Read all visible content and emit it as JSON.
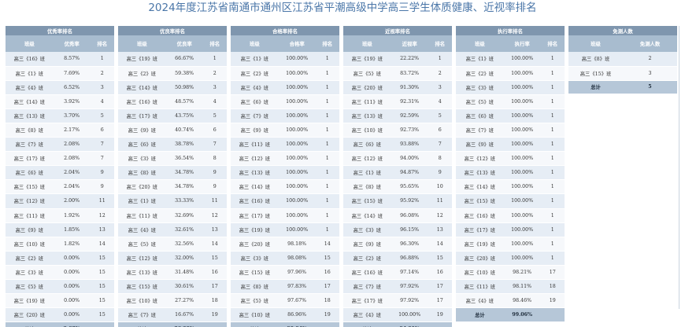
{
  "page_title": "2024年度江苏省南通市通州区江苏省平潮高级中学高三学生体质健康、近视率排名",
  "panels": [
    {
      "caption": "优秀率排名",
      "headers": [
        "班级",
        "优秀率",
        "排名"
      ],
      "rows": [
        [
          "高三《16》班",
          "8.57%",
          "1"
        ],
        [
          "高三《1》班",
          "7.69%",
          "2"
        ],
        [
          "高三《4》班",
          "6.52%",
          "3"
        ],
        [
          "高三《14》班",
          "3.92%",
          "4"
        ],
        [
          "高三《13》班",
          "3.70%",
          "5"
        ],
        [
          "高三《8》班",
          "2.17%",
          "6"
        ],
        [
          "高三《7》班",
          "2.08%",
          "7"
        ],
        [
          "高三《17》班",
          "2.08%",
          "7"
        ],
        [
          "高三《6》班",
          "2.04%",
          "9"
        ],
        [
          "高三《15》班",
          "2.04%",
          "9"
        ],
        [
          "高三《12》班",
          "2.00%",
          "11"
        ],
        [
          "高三《11》班",
          "1.92%",
          "12"
        ],
        [
          "高三《9》班",
          "1.85%",
          "13"
        ],
        [
          "高三《10》班",
          "1.82%",
          "14"
        ],
        [
          "高三《2》班",
          "0.00%",
          "15"
        ],
        [
          "高三《3》班",
          "0.00%",
          "15"
        ],
        [
          "高三《5》班",
          "0.00%",
          "15"
        ],
        [
          "高三《19》班",
          "0.00%",
          "15"
        ],
        [
          "高三《20》班",
          "0.00%",
          "15"
        ]
      ],
      "total": [
        "总计",
        "2.63%",
        ""
      ]
    },
    {
      "caption": "优良率排名",
      "headers": [
        "班级",
        "优良率",
        "排名"
      ],
      "rows": [
        [
          "高三《19》班",
          "66.67%",
          "1"
        ],
        [
          "高三《2》班",
          "59.38%",
          "2"
        ],
        [
          "高三《14》班",
          "50.98%",
          "3"
        ],
        [
          "高三《16》班",
          "48.57%",
          "4"
        ],
        [
          "高三《17》班",
          "43.75%",
          "5"
        ],
        [
          "高三《9》班",
          "40.74%",
          "6"
        ],
        [
          "高三《6》班",
          "38.78%",
          "7"
        ],
        [
          "高三《3》班",
          "36.54%",
          "8"
        ],
        [
          "高三《8》班",
          "34.78%",
          "9"
        ],
        [
          "高三《20》班",
          "34.78%",
          "9"
        ],
        [
          "高三《1》班",
          "33.33%",
          "11"
        ],
        [
          "高三《11》班",
          "32.69%",
          "12"
        ],
        [
          "高三《4》班",
          "32.61%",
          "13"
        ],
        [
          "高三《5》班",
          "32.56%",
          "14"
        ],
        [
          "高三《12》班",
          "32.00%",
          "15"
        ],
        [
          "高三《13》班",
          "31.48%",
          "16"
        ],
        [
          "高三《15》班",
          "30.61%",
          "17"
        ],
        [
          "高三《10》班",
          "27.27%",
          "18"
        ],
        [
          "高三《7》班",
          "16.67%",
          "19"
        ]
      ],
      "total": [
        "总计",
        "36.29%",
        ""
      ]
    },
    {
      "caption": "合格率排名",
      "headers": [
        "班级",
        "合格率",
        "排名"
      ],
      "rows": [
        [
          "高三《1》班",
          "100.00%",
          "1"
        ],
        [
          "高三《2》班",
          "100.00%",
          "1"
        ],
        [
          "高三《4》班",
          "100.00%",
          "1"
        ],
        [
          "高三《6》班",
          "100.00%",
          "1"
        ],
        [
          "高三《7》班",
          "100.00%",
          "1"
        ],
        [
          "高三《9》班",
          "100.00%",
          "1"
        ],
        [
          "高三《11》班",
          "100.00%",
          "1"
        ],
        [
          "高三《12》班",
          "100.00%",
          "1"
        ],
        [
          "高三《13》班",
          "100.00%",
          "1"
        ],
        [
          "高三《14》班",
          "100.00%",
          "1"
        ],
        [
          "高三《16》班",
          "100.00%",
          "1"
        ],
        [
          "高三《17》班",
          "100.00%",
          "1"
        ],
        [
          "高三《19》班",
          "100.00%",
          "1"
        ],
        [
          "高三《20》班",
          "98.18%",
          "14"
        ],
        [
          "高三《3》班",
          "98.08%",
          "15"
        ],
        [
          "高三《15》班",
          "97.96%",
          "16"
        ],
        [
          "高三《8》班",
          "97.83%",
          "17"
        ],
        [
          "高三《5》班",
          "97.67%",
          "18"
        ],
        [
          "高三《10》班",
          "86.96%",
          "19"
        ]
      ],
      "total": [
        "总计",
        "99.04%",
        ""
      ]
    },
    {
      "caption": "近视率排名",
      "headers": [
        "班级",
        "近视率",
        "排名"
      ],
      "rows": [
        [
          "高三《19》班",
          "22.22%",
          "1"
        ],
        [
          "高三《5》班",
          "83.72%",
          "2"
        ],
        [
          "高三《20》班",
          "91.30%",
          "3"
        ],
        [
          "高三《11》班",
          "92.31%",
          "4"
        ],
        [
          "高三《13》班",
          "92.59%",
          "5"
        ],
        [
          "高三《10》班",
          "92.73%",
          "6"
        ],
        [
          "高三《6》班",
          "93.88%",
          "7"
        ],
        [
          "高三《12》班",
          "94.00%",
          "8"
        ],
        [
          "高三《1》班",
          "94.87%",
          "9"
        ],
        [
          "高三《8》班",
          "95.65%",
          "10"
        ],
        [
          "高三《15》班",
          "95.92%",
          "11"
        ],
        [
          "高三《14》班",
          "96.08%",
          "12"
        ],
        [
          "高三《3》班",
          "96.15%",
          "13"
        ],
        [
          "高三《9》班",
          "96.30%",
          "14"
        ],
        [
          "高三《2》班",
          "96.88%",
          "15"
        ],
        [
          "高三《16》班",
          "97.14%",
          "16"
        ],
        [
          "高三《7》班",
          "97.92%",
          "17"
        ],
        [
          "高三《17》班",
          "97.92%",
          "17"
        ],
        [
          "高三《4》班",
          "100.00%",
          "19"
        ]
      ],
      "total": [
        "总计",
        "94.01%",
        ""
      ]
    },
    {
      "caption": "执行率排名",
      "headers": [
        "班级",
        "执行率",
        "排名"
      ],
      "rows": [
        [
          "高三《1》班",
          "100.00%",
          "1"
        ],
        [
          "高三《2》班",
          "100.00%",
          "1"
        ],
        [
          "高三《3》班",
          "100.00%",
          "1"
        ],
        [
          "高三《5》班",
          "100.00%",
          "1"
        ],
        [
          "高三《6》班",
          "100.00%",
          "1"
        ],
        [
          "高三《7》班",
          "100.00%",
          "1"
        ],
        [
          "高三《9》班",
          "100.00%",
          "1"
        ],
        [
          "高三《12》班",
          "100.00%",
          "1"
        ],
        [
          "高三《13》班",
          "100.00%",
          "1"
        ],
        [
          "高三《14》班",
          "100.00%",
          "1"
        ],
        [
          "高三《15》班",
          "100.00%",
          "1"
        ],
        [
          "高三《16》班",
          "100.00%",
          "1"
        ],
        [
          "高三《17》班",
          "100.00%",
          "1"
        ],
        [
          "高三《19》班",
          "100.00%",
          "1"
        ],
        [
          "高三《20》班",
          "100.00%",
          "1"
        ],
        [
          "高三《10》班",
          "98.21%",
          "17"
        ],
        [
          "高三《11》班",
          "98.11%",
          "18"
        ],
        [
          "高三《4》班",
          "98.46%",
          "19"
        ]
      ],
      "total": [
        "总计",
        "99.06%",
        ""
      ]
    },
    {
      "caption": "免测人数",
      "headers": [
        "班级",
        "免测人数"
      ],
      "rows": [
        [
          "高三《8》班",
          "2"
        ],
        [
          "高三《15》班",
          "3"
        ]
      ],
      "total": [
        "总计",
        "5"
      ]
    }
  ]
}
